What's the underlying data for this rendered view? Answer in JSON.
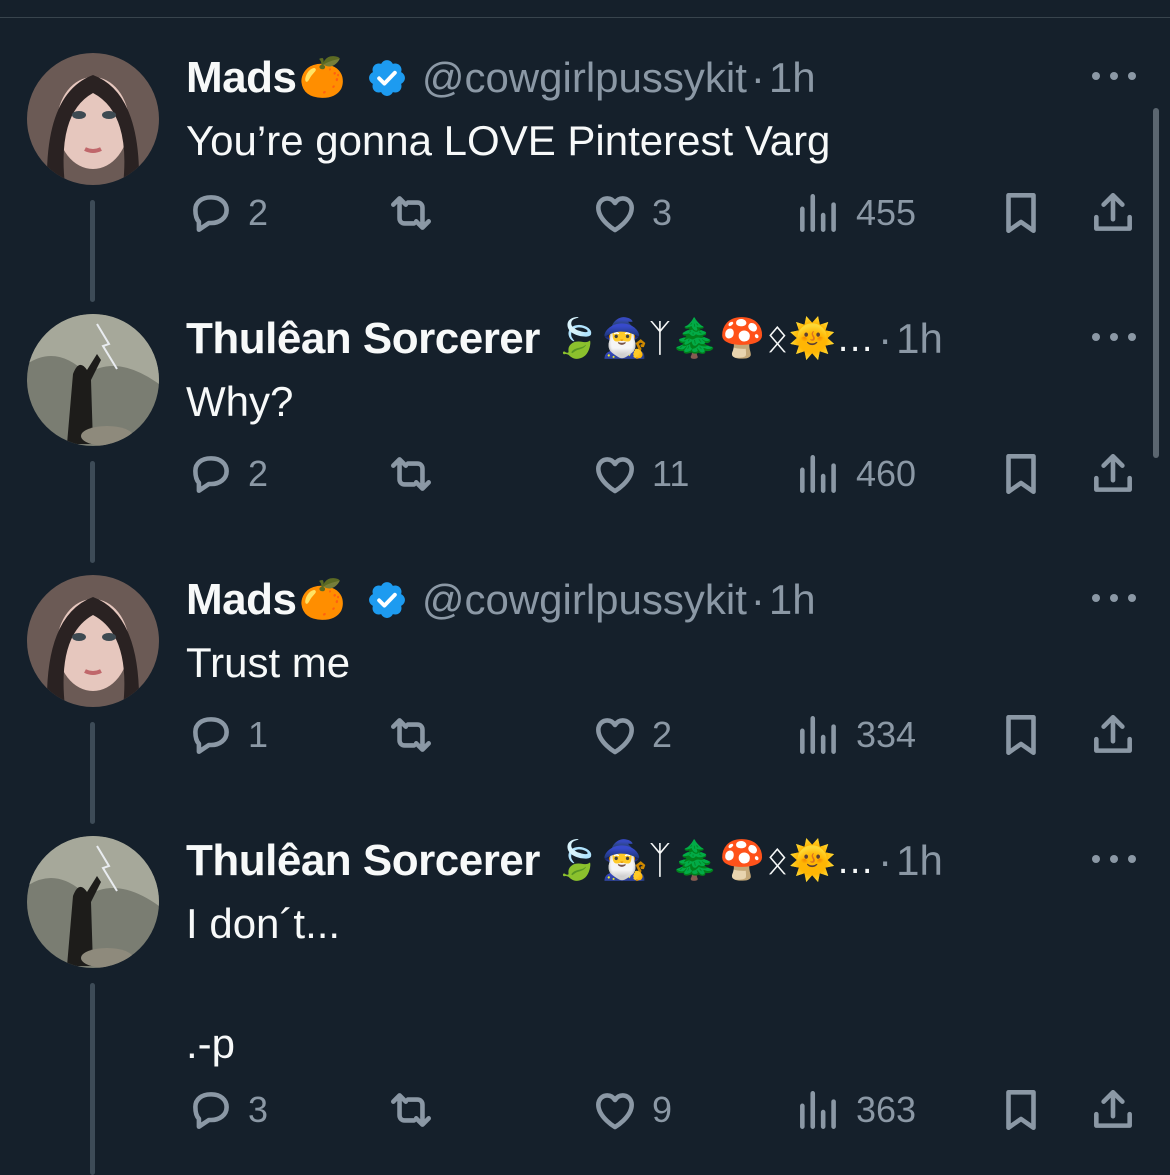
{
  "theme": {
    "background": "#15202b",
    "text": "#f7f9f9",
    "muted": "#8b98a5",
    "verified": "#1d9bf0",
    "line": "#3d4b57"
  },
  "tweets": [
    {
      "name": "Mads",
      "name_emoji": "🍊",
      "verified": true,
      "handle": "@cowgirlpussykit",
      "sep": "·",
      "time": "1h",
      "text": "You’re gonna LOVE Pinterest Varg",
      "replies": "2",
      "likes": "3",
      "views": "455",
      "avatar": "woman-photo-avatar"
    },
    {
      "name": "Thulêan Sorcerer",
      "name_emoji": "🍃🧙‍♂️ᛉ🌲🍄ᛟ🌞…",
      "verified": false,
      "handle": "",
      "sep": "·",
      "time": "1h",
      "text": "Why?",
      "replies": "2",
      "likes": "11",
      "views": "460",
      "avatar": "sorcerer-lightning-avatar"
    },
    {
      "name": "Mads",
      "name_emoji": "🍊",
      "verified": true,
      "handle": "@cowgirlpussykit",
      "sep": "·",
      "time": "1h",
      "text": "Trust me",
      "replies": "1",
      "likes": "2",
      "views": "334",
      "avatar": "woman-photo-avatar"
    },
    {
      "name": "Thulêan Sorcerer",
      "name_emoji": "🍃🧙‍♂️ᛉ🌲🍄ᛟ🌞…",
      "verified": false,
      "handle": "",
      "sep": "·",
      "time": "1h",
      "text": "I don´t...\n\n.-p",
      "replies": "3",
      "likes": "9",
      "views": "363",
      "avatar": "sorcerer-lightning-avatar"
    }
  ]
}
